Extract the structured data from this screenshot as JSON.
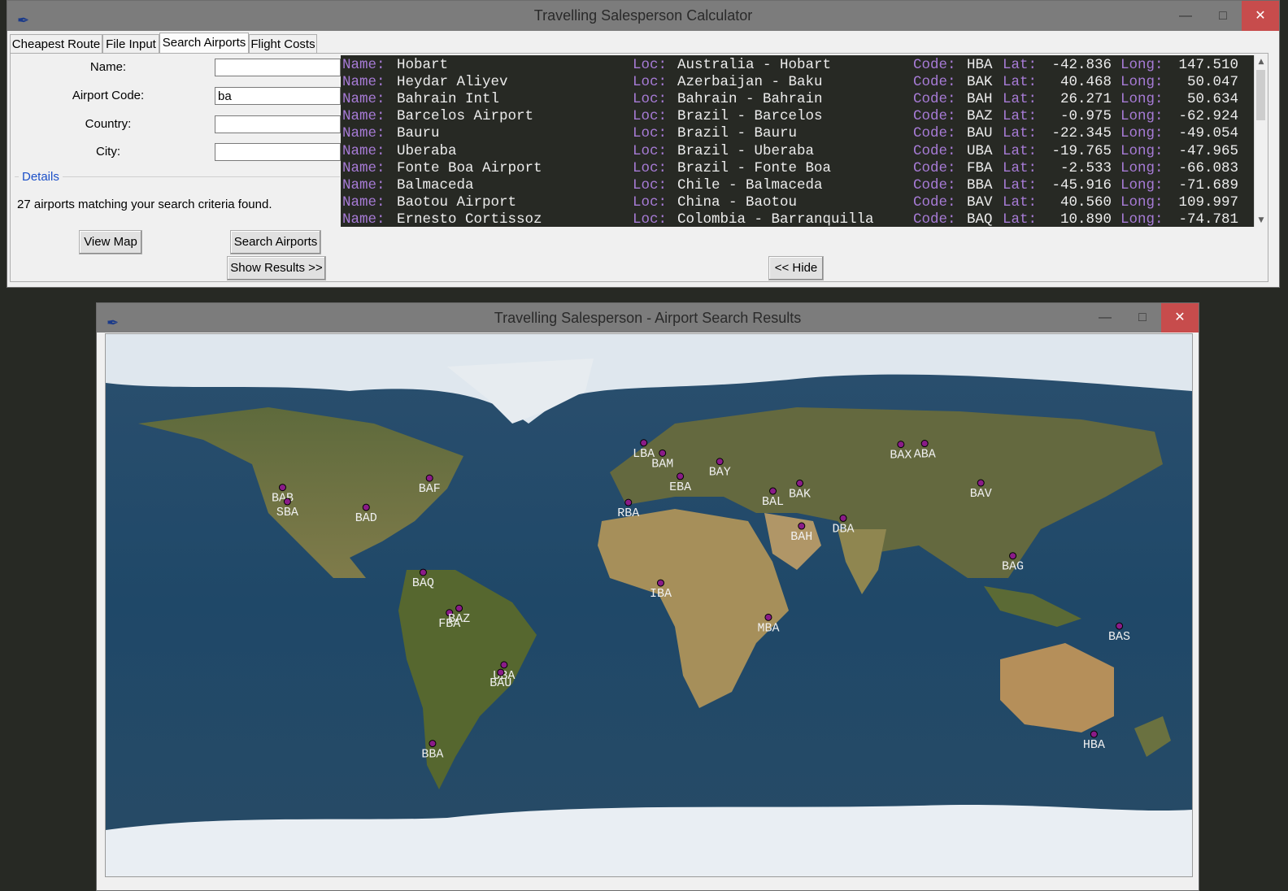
{
  "main_window": {
    "title": "Travelling Salesperson Calculator",
    "tabs": [
      "Cheapest Route",
      "File Input",
      "Search Airports",
      "Flight Costs"
    ],
    "active_tab": "Search Airports",
    "form": {
      "name_label": "Name:",
      "name_value": "",
      "code_label": "Airport Code:",
      "code_value": "ba",
      "country_label": "Country:",
      "country_value": "",
      "city_label": "City:",
      "city_value": ""
    },
    "details_label": "Details",
    "details_text": "27 airports matching your search criteria found.",
    "buttons": {
      "view_map": "View Map",
      "search": "Search Airports",
      "show_results": "Show Results >>",
      "hide": "<< Hide"
    },
    "result_keys": {
      "name": "Name:",
      "loc": "Loc:",
      "code": "Code:",
      "lat": "Lat:",
      "long": "Long:"
    },
    "results": [
      {
        "name": "Hobart",
        "loc": "Australia - Hobart",
        "code": "HBA",
        "lat": "-42.836",
        "long": "147.510"
      },
      {
        "name": "Heydar Aliyev",
        "loc": "Azerbaijan - Baku",
        "code": "BAK",
        "lat": "40.468",
        "long": "50.047"
      },
      {
        "name": "Bahrain Intl",
        "loc": "Bahrain - Bahrain",
        "code": "BAH",
        "lat": "26.271",
        "long": "50.634"
      },
      {
        "name": "Barcelos Airport",
        "loc": "Brazil - Barcelos",
        "code": "BAZ",
        "lat": "-0.975",
        "long": "-62.924"
      },
      {
        "name": "Bauru",
        "loc": "Brazil - Bauru",
        "code": "BAU",
        "lat": "-22.345",
        "long": "-49.054"
      },
      {
        "name": "Uberaba",
        "loc": "Brazil - Uberaba",
        "code": "UBA",
        "lat": "-19.765",
        "long": "-47.965"
      },
      {
        "name": "Fonte Boa Airport",
        "loc": "Brazil - Fonte Boa",
        "code": "FBA",
        "lat": "-2.533",
        "long": "-66.083"
      },
      {
        "name": "Balmaceda",
        "loc": "Chile - Balmaceda",
        "code": "BBA",
        "lat": "-45.916",
        "long": "-71.689"
      },
      {
        "name": "Baotou Airport",
        "loc": "China - Baotou",
        "code": "BAV",
        "lat": "40.560",
        "long": "109.997"
      },
      {
        "name": "Ernesto Cortissoz",
        "loc": "Colombia - Barranquilla",
        "code": "BAQ",
        "lat": "10.890",
        "long": "-74.781"
      }
    ]
  },
  "map_window": {
    "title": "Travelling Salesperson - Airport Search Results",
    "markers": [
      {
        "code": "BAB",
        "lat": 39.1,
        "lon": -121.4
      },
      {
        "code": "SBA",
        "lat": 34.4,
        "lon": -119.8
      },
      {
        "code": "BAD",
        "lat": 32.5,
        "lon": -93.7
      },
      {
        "code": "BAF",
        "lat": 42.2,
        "lon": -72.7
      },
      {
        "code": "BAQ",
        "lat": 10.9,
        "lon": -74.8
      },
      {
        "code": "FBA",
        "lat": -2.5,
        "lon": -66.1
      },
      {
        "code": "BAZ",
        "lat": -1.0,
        "lon": -62.9
      },
      {
        "code": "UBA",
        "lat": -19.8,
        "lon": -48.0
      },
      {
        "code": "BAU",
        "lat": -22.3,
        "lon": -49.1
      },
      {
        "code": "BBA",
        "lat": -45.9,
        "lon": -71.7
      },
      {
        "code": "LBA",
        "lat": 53.9,
        "lon": -1.7
      },
      {
        "code": "BAM",
        "lat": 50.5,
        "lon": 4.5
      },
      {
        "code": "EBA",
        "lat": 42.8,
        "lon": 10.4
      },
      {
        "code": "BAY",
        "lat": 47.7,
        "lon": 23.5
      },
      {
        "code": "RBA",
        "lat": 34.1,
        "lon": -6.8
      },
      {
        "code": "BAL",
        "lat": 37.9,
        "lon": 41.1
      },
      {
        "code": "BAK",
        "lat": 40.5,
        "lon": 50.0
      },
      {
        "code": "BAH",
        "lat": 26.3,
        "lon": 50.6
      },
      {
        "code": "DBA",
        "lat": 28.9,
        "lon": 64.4
      },
      {
        "code": "IBA",
        "lat": 7.4,
        "lon": 3.9
      },
      {
        "code": "MBA",
        "lat": -4.0,
        "lon": 39.6
      },
      {
        "code": "BAX",
        "lat": 53.4,
        "lon": 83.5
      },
      {
        "code": "ABA",
        "lat": 53.7,
        "lon": 91.4
      },
      {
        "code": "BAV",
        "lat": 40.6,
        "lon": 110.0
      },
      {
        "code": "BAG",
        "lat": 16.4,
        "lon": 120.6
      },
      {
        "code": "BAS",
        "lat": -6.9,
        "lon": 155.9
      },
      {
        "code": "HBA",
        "lat": -42.8,
        "lon": 147.5
      }
    ]
  }
}
